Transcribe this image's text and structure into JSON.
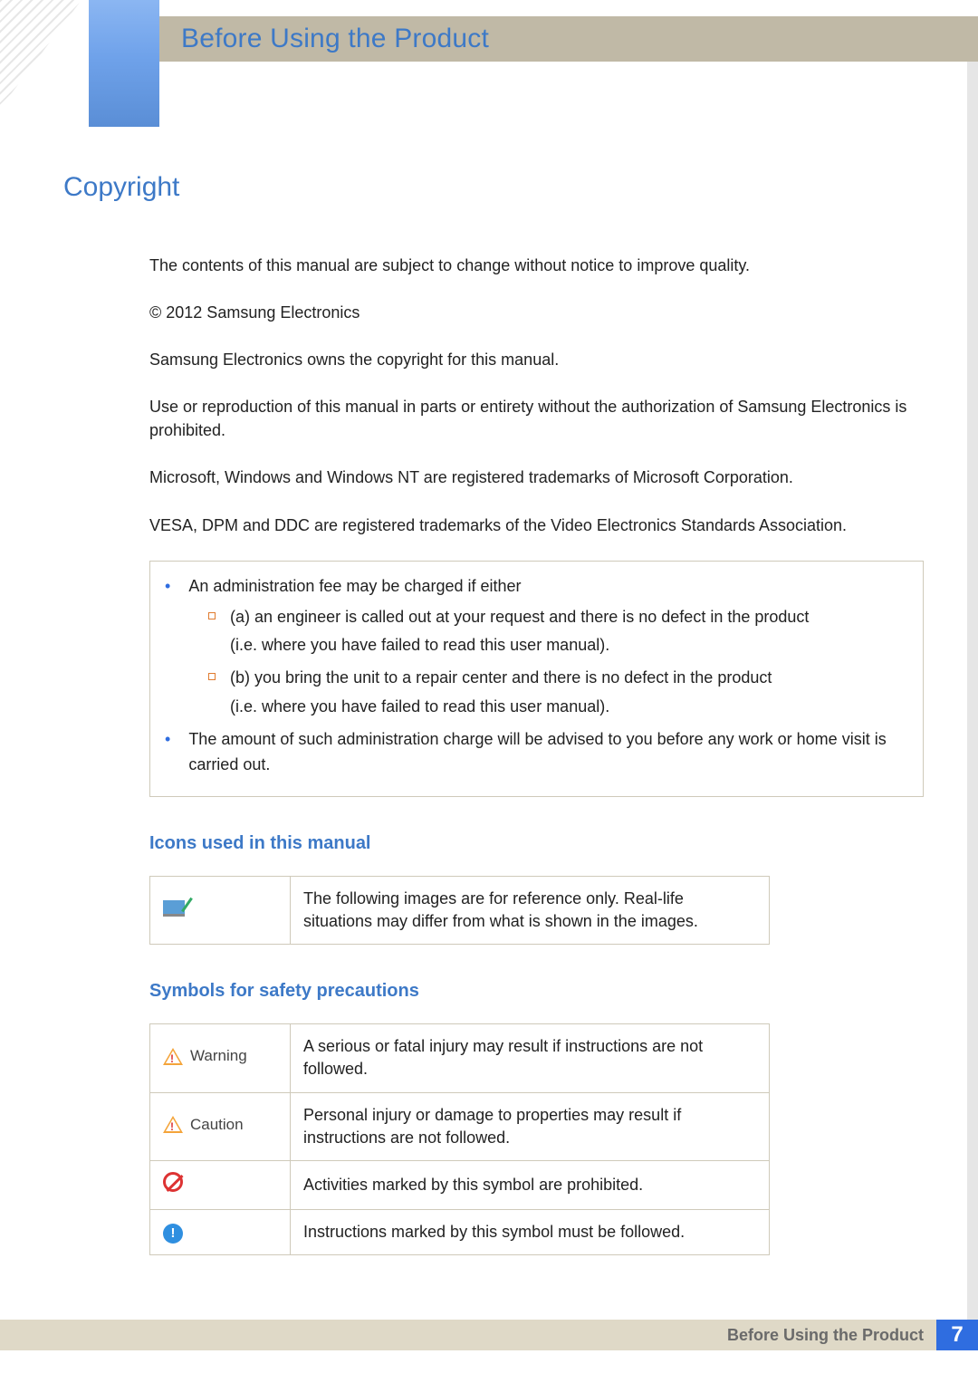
{
  "header": {
    "title": "Before Using the Product"
  },
  "h2": "Copyright",
  "paras": {
    "p1": "The contents of this manual are subject to change without notice to improve quality.",
    "p2": "© 2012 Samsung Electronics",
    "p3": "Samsung Electronics owns the copyright for this manual.",
    "p4": "Use or reproduction of this manual in parts or entirety without the authorization of Samsung Electronics is prohibited.",
    "p5": "Microsoft, Windows and Windows NT are registered trademarks of Microsoft Corporation.",
    "p6": "VESA, DPM and DDC are registered trademarks of the Video Electronics Standards Association."
  },
  "admin": {
    "b1": "An administration fee may be charged if either",
    "a": "(a) an engineer is called out at your request and there is no defect in the product",
    "a2": "(i.e. where you have failed to read this user manual).",
    "b": "(b) you bring the unit to a repair center and there is no defect in the product",
    "b2_line": "(i.e. where you have failed to read this user manual).",
    "b2": "The amount of such administration charge will be advised to you before any work or home visit is carried out."
  },
  "h3a": "Icons used in this manual",
  "icons_table": {
    "desc": "The following images are for reference only. Real-life situations may differ from what is shown in the images."
  },
  "h3b": "Symbols for safety precautions",
  "symbols": {
    "warning_label": "Warning",
    "warning_desc": "A serious or fatal injury may result if instructions are not followed.",
    "caution_label": "Caution",
    "caution_desc": "Personal injury or damage to properties may result if instructions are not followed.",
    "prohibit_desc": "Activities marked by this symbol are prohibited.",
    "must_desc": "Instructions marked by this symbol must be followed."
  },
  "footer": {
    "label": "Before Using the Product",
    "page": "7"
  }
}
